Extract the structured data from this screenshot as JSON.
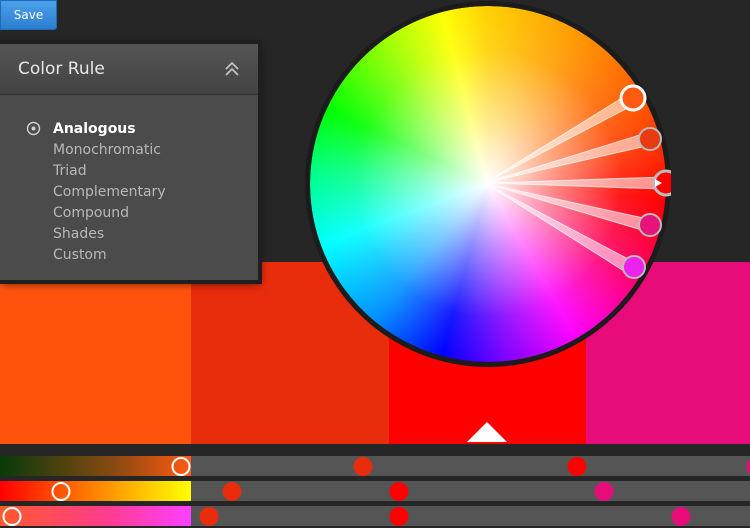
{
  "toolbar": {
    "save_label": "Save"
  },
  "color_rule_panel": {
    "title": "Color Rule",
    "selected": "Analogous",
    "rules": [
      "Analogous",
      "Monochromatic",
      "Triad",
      "Complementary",
      "Compound",
      "Shades",
      "Custom"
    ]
  },
  "swatches": [
    {
      "name": "swatch-1",
      "color": "#FF530D"
    },
    {
      "name": "swatch-2",
      "color": "#E82C0C"
    },
    {
      "name": "swatch-3",
      "color": "#FF0000"
    },
    {
      "name": "swatch-4",
      "color": "#E80C7A"
    }
  ],
  "active_swatch": 3,
  "colors": {
    "background": "#262626",
    "panel": "#4b4b4b",
    "accent_button": "#2c7fd0",
    "slider_track": "#555555"
  }
}
